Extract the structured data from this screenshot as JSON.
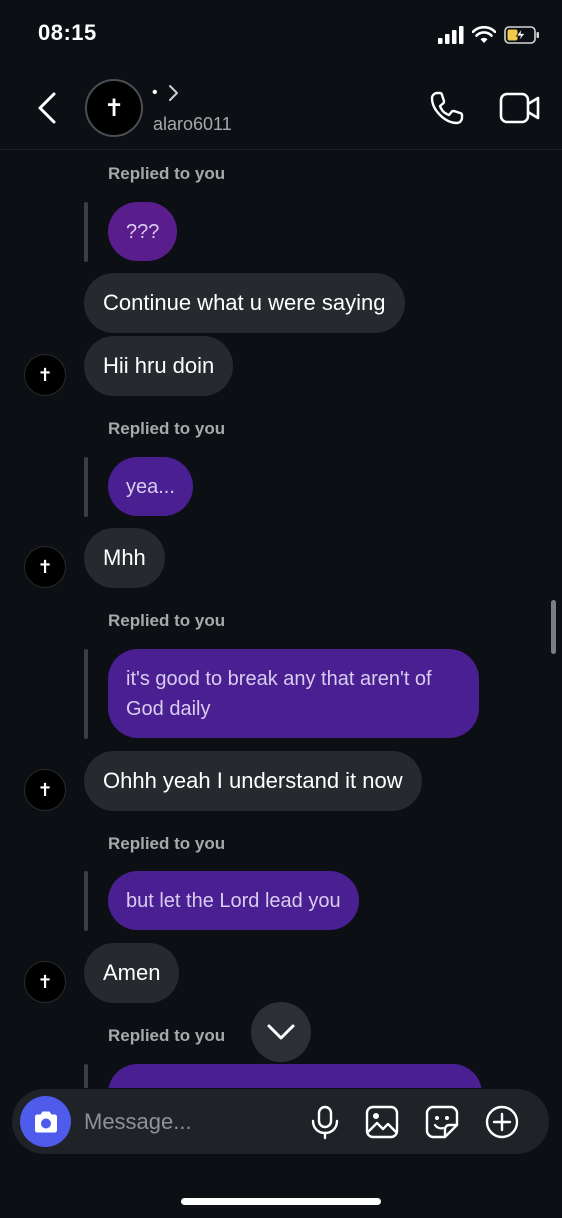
{
  "status_bar": {
    "time": "08:15",
    "icons": [
      "signal-icon",
      "wifi-icon",
      "battery-charging-icon"
    ]
  },
  "header": {
    "name_dot": "•",
    "avatar_glyph": "✝",
    "username": "alaro6011"
  },
  "messages": [
    {
      "type": "reply",
      "label": "Replied to you",
      "quoted": "???"
    },
    {
      "type": "received",
      "text": "Continue what u were saying"
    },
    {
      "type": "received",
      "text": "Hii hru doin",
      "avatar": "✝"
    },
    {
      "type": "reply",
      "label": "Replied to you",
      "quoted": "yea..."
    },
    {
      "type": "received",
      "text": "Mhh",
      "avatar": "✝"
    },
    {
      "type": "reply",
      "label": "Replied to you",
      "quoted": "it's good to break any that aren't of God daily"
    },
    {
      "type": "received",
      "text": "Ohhh yeah I understand it now",
      "avatar": "✝"
    },
    {
      "type": "reply",
      "label": "Replied to you",
      "quoted": "but let the Lord lead you"
    },
    {
      "type": "received",
      "text": "Amen",
      "avatar": "✝"
    },
    {
      "type": "reply",
      "label": "Replied to you",
      "quoted": ""
    }
  ],
  "composer": {
    "placeholder": "Message..."
  },
  "colors": {
    "background": "#0c1014",
    "received_bubble": "#262a2f",
    "quoted_bubble": "#4a1f91",
    "camera_button": "#4f5bea"
  }
}
